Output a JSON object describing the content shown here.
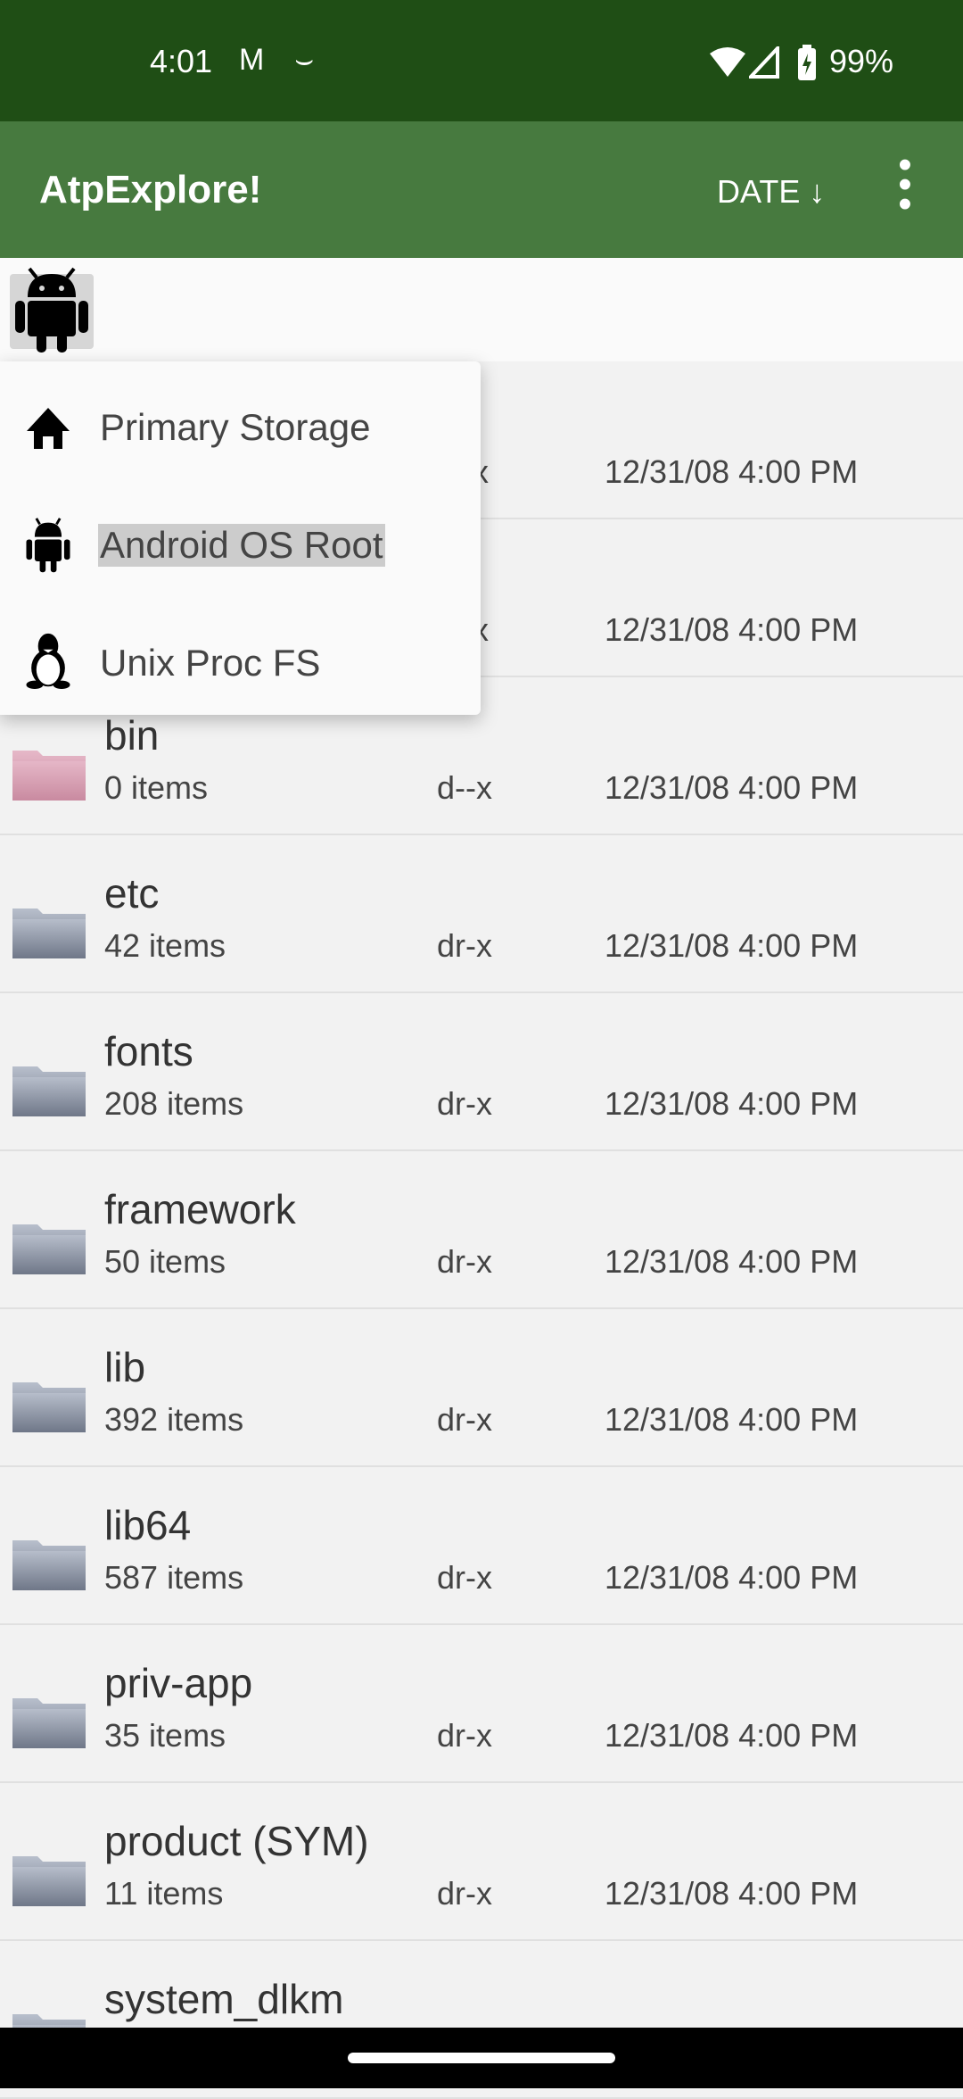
{
  "status_bar": {
    "time": "4:01",
    "battery": "99%",
    "icons": [
      "gmail-icon",
      "amazon-icon",
      "wifi-icon",
      "signal-icon",
      "battery-charging-icon"
    ]
  },
  "app_bar": {
    "title": "AtpExplore!",
    "sort_label": "DATE",
    "sort_icon": "arrow-down-icon",
    "more_icon": "more-vert-icon",
    "color": "#477a3f"
  },
  "root_button": {
    "icon": "android-icon"
  },
  "menu": {
    "items": [
      {
        "label": "Primary Storage",
        "icon": "home-icon"
      },
      {
        "label": "Android OS Root",
        "icon": "android-icon",
        "selected": true
      },
      {
        "label": "Unix Proc FS",
        "icon": "tux-icon"
      }
    ]
  },
  "files": [
    {
      "name": "",
      "count": "",
      "perm": "x",
      "date": "12/31/08 4:00 PM"
    },
    {
      "name": "",
      "count": "",
      "perm": "x",
      "date": "12/31/08 4:00 PM"
    },
    {
      "name": "bin",
      "count": "0 items",
      "perm": "d--x",
      "date": "12/31/08 4:00 PM",
      "folder_color": "pink"
    },
    {
      "name": "etc",
      "count": "42 items",
      "perm": "dr-x",
      "date": "12/31/08 4:00 PM"
    },
    {
      "name": "fonts",
      "count": "208 items",
      "perm": "dr-x",
      "date": "12/31/08 4:00 PM"
    },
    {
      "name": "framework",
      "count": "50 items",
      "perm": "dr-x",
      "date": "12/31/08 4:00 PM"
    },
    {
      "name": "lib",
      "count": "392 items",
      "perm": "dr-x",
      "date": "12/31/08 4:00 PM"
    },
    {
      "name": "lib64",
      "count": "587 items",
      "perm": "dr-x",
      "date": "12/31/08 4:00 PM"
    },
    {
      "name": "priv-app",
      "count": "35 items",
      "perm": "dr-x",
      "date": "12/31/08 4:00 PM"
    },
    {
      "name": "product (SYM)",
      "count": "11 items",
      "perm": "dr-x",
      "date": "12/31/08 4:00 PM"
    },
    {
      "name": "system_dlkm",
      "count": "",
      "perm": "",
      "date": ""
    }
  ]
}
